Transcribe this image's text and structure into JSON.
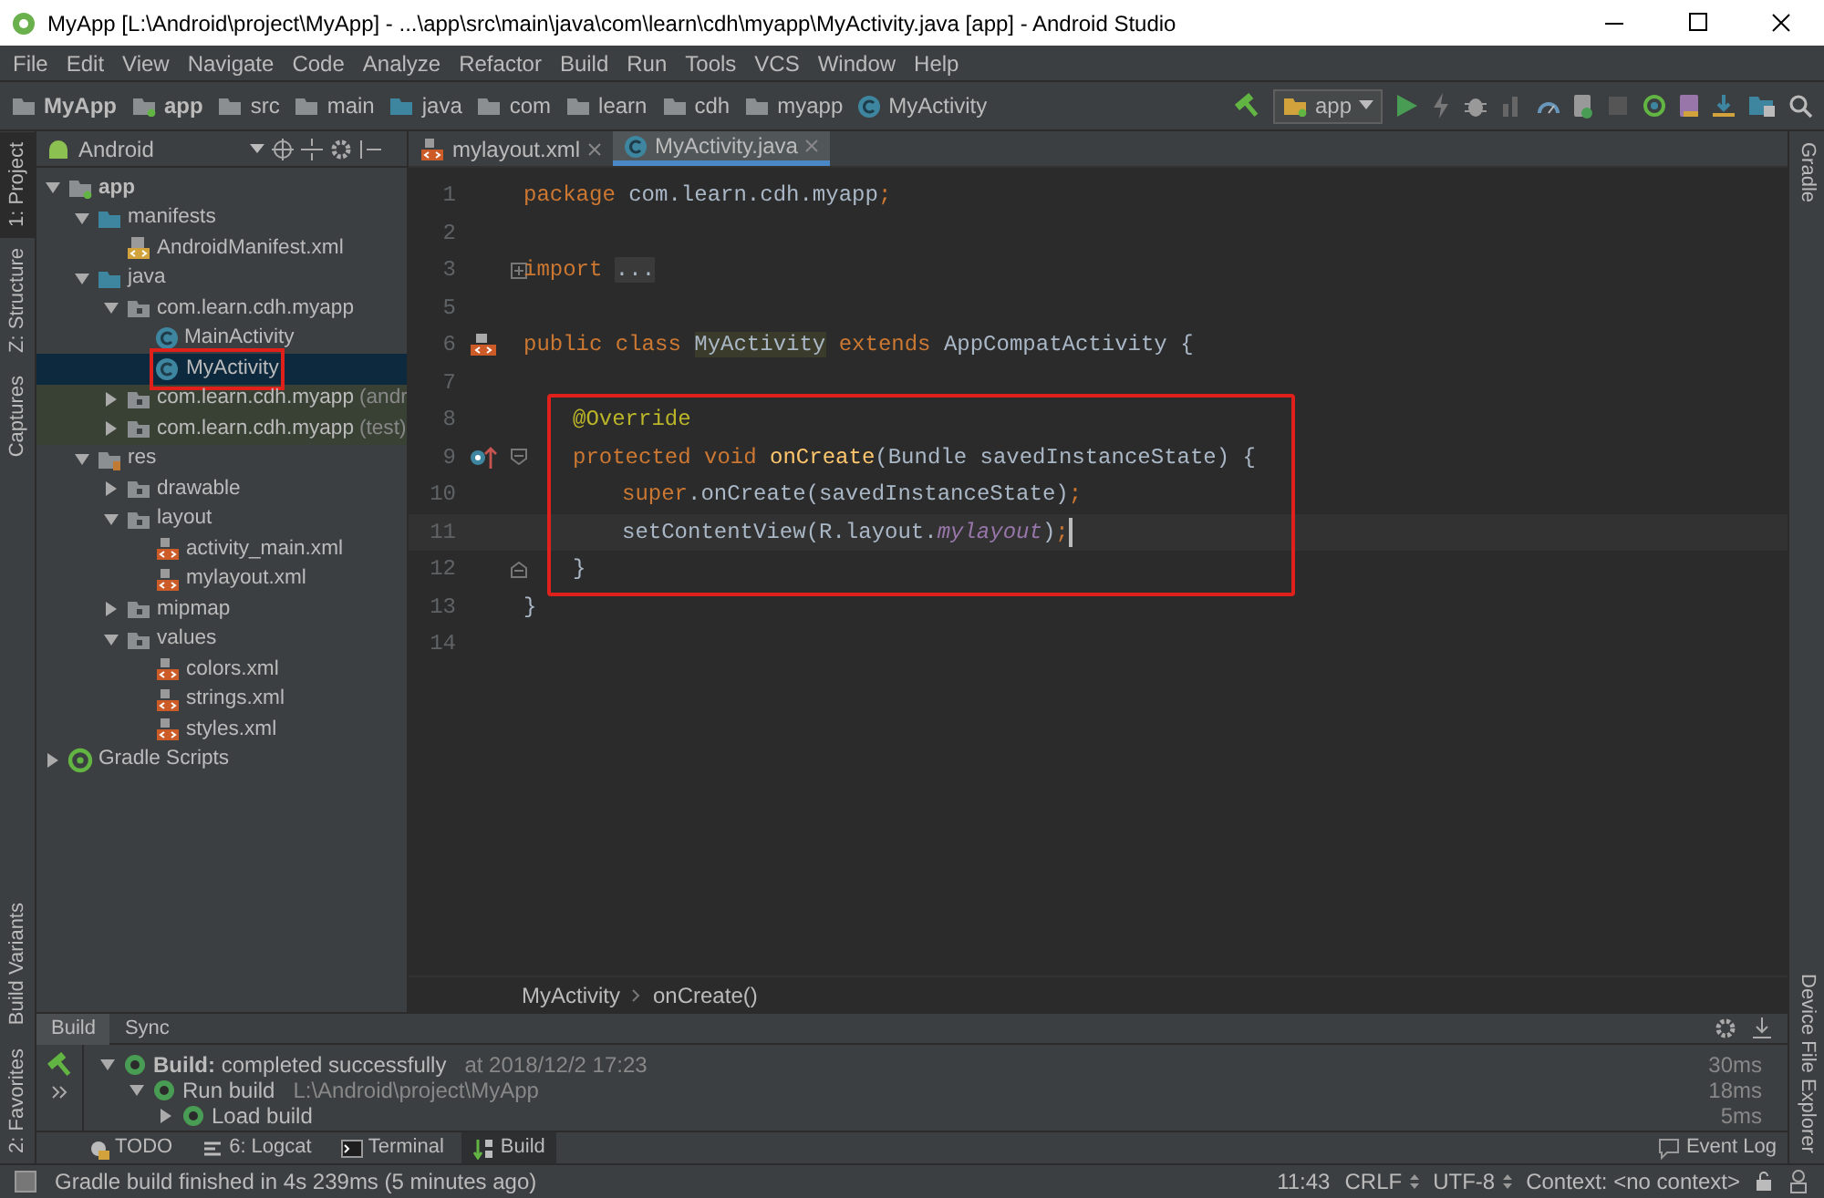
{
  "window": {
    "title": "MyApp [L:\\Android\\project\\MyApp] - ...\\app\\src\\main\\java\\com\\learn\\cdh\\myapp\\MyActivity.java [app] - Android Studio"
  },
  "menu": [
    "File",
    "Edit",
    "View",
    "Navigate",
    "Code",
    "Analyze",
    "Refactor",
    "Build",
    "Run",
    "Tools",
    "VCS",
    "Window",
    "Help"
  ],
  "nav_path": [
    {
      "label": "MyApp",
      "kind": "project"
    },
    {
      "label": "app",
      "kind": "module"
    },
    {
      "label": "src",
      "kind": "folder"
    },
    {
      "label": "main",
      "kind": "folder"
    },
    {
      "label": "java",
      "kind": "source"
    },
    {
      "label": "com",
      "kind": "folder"
    },
    {
      "label": "learn",
      "kind": "folder"
    },
    {
      "label": "cdh",
      "kind": "folder"
    },
    {
      "label": "myapp",
      "kind": "folder"
    },
    {
      "label": "MyActivity",
      "kind": "class"
    }
  ],
  "run_config": "app",
  "left_tool_tabs": [
    {
      "label": "1: Project",
      "selected": true
    },
    {
      "label": "Z: Structure",
      "selected": false
    },
    {
      "label": "Captures",
      "selected": false
    }
  ],
  "left_tool_tabs_bottom": [
    {
      "label": "Build Variants",
      "selected": false
    },
    {
      "label": "2: Favorites",
      "selected": false
    }
  ],
  "right_tool_tabs": [
    {
      "label": "Gradle"
    },
    {
      "label": "Device File Explorer"
    }
  ],
  "project": {
    "view": "Android",
    "tree": [
      {
        "label": "app",
        "kind": "module",
        "expanded": true,
        "selected": false,
        "children": [
          {
            "label": "manifests",
            "kind": "source",
            "expanded": true,
            "selected": false,
            "children": [
              {
                "label": "AndroidManifest.xml",
                "kind": "manifest",
                "selected": false
              }
            ]
          },
          {
            "label": "java",
            "kind": "source",
            "expanded": true,
            "selected": false,
            "children": [
              {
                "label": "com.learn.cdh.myapp",
                "kind": "package",
                "expanded": true,
                "selected": false,
                "children": [
                  {
                    "label": "MainActivity",
                    "kind": "class",
                    "selected": false
                  },
                  {
                    "label": "MyActivity",
                    "kind": "class",
                    "selected": true,
                    "annotated": true
                  }
                ]
              },
              {
                "label": "com.learn.cdh.myapp",
                "suffix": "(andr",
                "kind": "package",
                "expanded": false,
                "selected": false,
                "tinted": true
              },
              {
                "label": "com.learn.cdh.myapp",
                "suffix": "(test)",
                "kind": "package",
                "expanded": false,
                "selected": false,
                "tinted": true
              }
            ]
          },
          {
            "label": "res",
            "kind": "res",
            "expanded": true,
            "selected": false,
            "children": [
              {
                "label": "drawable",
                "kind": "package",
                "expanded": false,
                "selected": false
              },
              {
                "label": "layout",
                "kind": "package",
                "expanded": true,
                "selected": false,
                "children": [
                  {
                    "label": "activity_main.xml",
                    "kind": "xml",
                    "selected": false
                  },
                  {
                    "label": "mylayout.xml",
                    "kind": "xml",
                    "selected": false
                  }
                ]
              },
              {
                "label": "mipmap",
                "kind": "package",
                "expanded": false,
                "selected": false
              },
              {
                "label": "values",
                "kind": "package",
                "expanded": true,
                "selected": false,
                "children": [
                  {
                    "label": "colors.xml",
                    "kind": "xml",
                    "selected": false
                  },
                  {
                    "label": "strings.xml",
                    "kind": "xml",
                    "selected": false
                  },
                  {
                    "label": "styles.xml",
                    "kind": "xml",
                    "selected": false
                  }
                ]
              }
            ]
          }
        ]
      },
      {
        "label": "Gradle Scripts",
        "kind": "gradle",
        "expanded": false,
        "selected": false
      }
    ]
  },
  "editor": {
    "tabs": [
      {
        "label": "mylayout.xml",
        "kind": "xml",
        "selected": false
      },
      {
        "label": "MyActivity.java",
        "kind": "class",
        "selected": true
      }
    ],
    "lines": [
      {
        "number": "1",
        "tokens": [
          {
            "text": "package ",
            "kind": "keyword"
          },
          {
            "text": "com.learn.cdh.myapp",
            "kind": "plain"
          },
          {
            "text": ";",
            "kind": "keyword"
          }
        ]
      },
      {
        "number": "2"
      },
      {
        "number": "3",
        "fold": {
          "kind": "collapsed"
        },
        "tokens": [
          {
            "text": "import ",
            "kind": "keyword"
          },
          {
            "text": "...",
            "kind": "folded"
          }
        ]
      },
      {
        "number": "5"
      },
      {
        "number": "6",
        "gutter": {
          "kind": "layout"
        },
        "tokens": [
          {
            "text": "public class ",
            "kind": "keyword"
          },
          {
            "text": "MyActivity",
            "kind": "declaration"
          },
          {
            "text": " extends ",
            "kind": "keyword"
          },
          {
            "text": "AppCompatActivity {",
            "kind": "plain"
          }
        ],
        "children": [
          {
            "number": "7"
          },
          {
            "number": "8",
            "annotated": true,
            "tokens": [
              {
                "text": "@Override",
                "kind": "annotation"
              }
            ]
          },
          {
            "number": "9",
            "annotated": true,
            "gutter": {
              "kind": "override"
            },
            "fold": {
              "kind": "start"
            },
            "tokens": [
              {
                "text": "protected void ",
                "kind": "keyword"
              },
              {
                "text": "onCreate",
                "kind": "method"
              },
              {
                "text": "(Bundle savedInstanceState) {",
                "kind": "plain"
              }
            ],
            "children": [
              {
                "number": "10",
                "annotated": true,
                "tokens": [
                  {
                    "text": "super",
                    "kind": "keyword"
                  },
                  {
                    "text": ".onCreate(savedInstanceState)",
                    "kind": "plain"
                  },
                  {
                    "text": ";",
                    "kind": "keyword"
                  }
                ]
              },
              {
                "number": "11",
                "annotated": true,
                "current": true,
                "tokens": [
                  {
                    "text": "setContentView(R.layout.",
                    "kind": "plain"
                  },
                  {
                    "text": "mylayout",
                    "kind": "field"
                  },
                  {
                    "text": ")",
                    "kind": "plain"
                  },
                  {
                    "text": ";",
                    "kind": "keyword"
                  }
                ]
              }
            ]
          },
          {
            "number": "12",
            "annotated": true,
            "fold": {
              "kind": "end"
            },
            "tokens": [
              {
                "text": "}",
                "kind": "plain"
              }
            ]
          }
        ]
      },
      {
        "number": "13",
        "tokens": [
          {
            "text": "}",
            "kind": "plain"
          }
        ]
      },
      {
        "number": "14"
      }
    ],
    "breadcrumb": [
      "MyActivity",
      "onCreate()"
    ]
  },
  "build": {
    "tabs": [
      {
        "label": "Build",
        "selected": true
      },
      {
        "label": "Sync",
        "selected": false
      }
    ],
    "rows": [
      {
        "label": "completed successfully",
        "prefix": "Build:",
        "detail": "at 2018/12/2 17:23",
        "expanded": true,
        "timing": "30ms",
        "children": [
          {
            "label": "Run build",
            "detail": "L:\\Android\\project\\MyApp",
            "expanded": true,
            "timing": "18ms",
            "children": [
              {
                "label": "Load build",
                "expanded": false,
                "timing": "5ms"
              }
            ]
          }
        ]
      }
    ]
  },
  "tool_tabs": [
    {
      "label": "TODO",
      "kind": "todo",
      "selected": false
    },
    {
      "label": "6: Logcat",
      "kind": "logcat",
      "selected": false
    },
    {
      "label": "Terminal",
      "kind": "terminal",
      "selected": false
    },
    {
      "label": "Build",
      "kind": "build",
      "selected": true
    }
  ],
  "event_log": "Event Log",
  "status_bar": {
    "message": "Gradle build finished in 4s 239ms (5 minutes ago)",
    "position": "11:43",
    "line_separator": "CRLF",
    "encoding": "UTF-8",
    "context": "Context: <no context>"
  }
}
